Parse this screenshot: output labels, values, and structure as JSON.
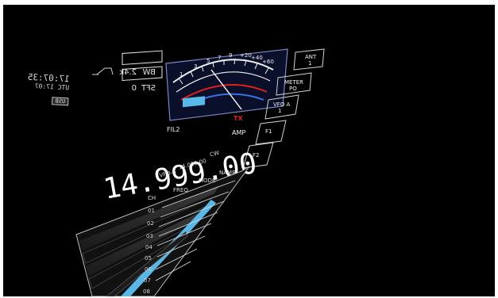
{
  "clock": {
    "time": "17:07:35",
    "utc_label": "UTC 17:07",
    "badge": "USB"
  },
  "filter_panel": {
    "bw_label": "BW",
    "bw_value": "2.4k",
    "sft_label": "SFT",
    "sft_value": "0"
  },
  "meter": {
    "scale_labels": [
      "1",
      "3",
      "5",
      "7",
      "9",
      "+20",
      "+40",
      "+60"
    ]
  },
  "side_buttons": [
    {
      "label": "ANT",
      "sub": "1"
    },
    {
      "label": "METER",
      "sub": "PO"
    },
    {
      "label": "VFO A",
      "sub": "1"
    },
    {
      "label": "F1"
    },
    {
      "label": "F2"
    }
  ],
  "status": {
    "fil_label": "FIL2",
    "mode": "USB",
    "agc": "TX",
    "mode2": "AMP"
  },
  "frequency": {
    "main": "14.999.00",
    "sub_label": "VFO-B",
    "sub_value": "14.000.00",
    "sub_mode": "CW"
  },
  "memory_list": {
    "header": [
      "CH",
      "FREQ",
      "MODE",
      "NAME"
    ],
    "rows": [
      "01",
      "02",
      "03",
      "04",
      "05",
      "06",
      "07",
      "08"
    ],
    "selected_index": 5
  },
  "colors": {
    "accent_blue": "#58b8e8",
    "meter_red": "#e02020",
    "meter_blue": "#3a70e0",
    "panel_line": "#c8c8c8"
  }
}
